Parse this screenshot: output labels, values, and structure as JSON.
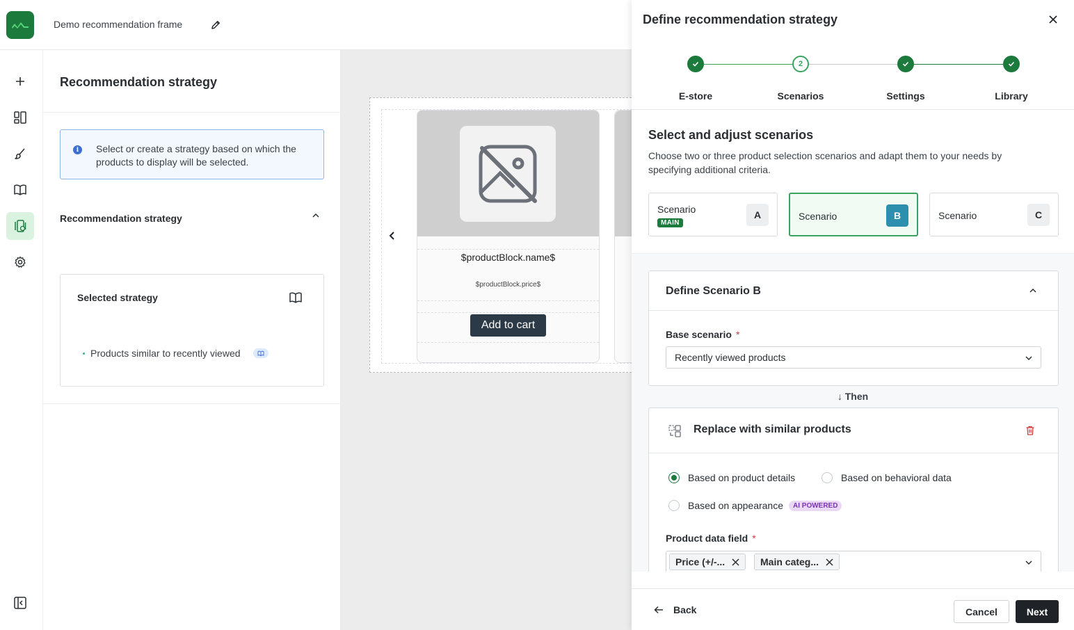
{
  "header": {
    "frame_title": "Demo recommendation frame",
    "logo_icon": "brand-logo",
    "edit_icon": "pencil-icon"
  },
  "rail": {
    "items": [
      {
        "icon": "plus-icon"
      },
      {
        "icon": "layout-icon"
      },
      {
        "icon": "brush-icon"
      },
      {
        "icon": "book-icon"
      },
      {
        "icon": "recommendation-icon",
        "active": true
      },
      {
        "icon": "gear-icon"
      },
      {
        "icon": "collapse-panel-icon"
      }
    ]
  },
  "panel": {
    "title": "Recommendation strategy",
    "info_text": "Select or create a strategy based on which the products to display will be selected.",
    "section_title": "Recommendation strategy",
    "selected": {
      "title": "Selected strategy",
      "item": "Products similar to recently viewed"
    }
  },
  "preview": {
    "product_name": "$productBlock.name$",
    "product_price": "$productBlock.price$",
    "cart_label": "Add to cart"
  },
  "drawer": {
    "title": "Define recommendation strategy",
    "steps": [
      {
        "label": "E-store",
        "state": "done"
      },
      {
        "label": "Scenarios",
        "state": "current",
        "number": "2"
      },
      {
        "label": "Settings",
        "state": "done"
      },
      {
        "label": "Library",
        "state": "done"
      }
    ],
    "section_title": "Select and adjust scenarios",
    "section_desc": "Choose two or three product selection scenarios and adapt them to your needs by specifying additional criteria.",
    "scenarios": [
      {
        "label": "Scenario",
        "letter": "A",
        "badge": "MAIN"
      },
      {
        "label": "Scenario",
        "letter": "B",
        "selected": true
      },
      {
        "label": "Scenario",
        "letter": "C"
      }
    ],
    "define": {
      "title": "Define Scenario B",
      "base_label": "Base scenario",
      "required_mark": "*",
      "base_value": "Recently viewed products"
    },
    "then_label": "Then",
    "replace": {
      "title": "Replace with similar products",
      "options": [
        {
          "label": "Based on product details",
          "checked": true
        },
        {
          "label": "Based on behavioral data",
          "checked": false
        },
        {
          "label": "Based on appearance",
          "checked": false,
          "badge": "AI POWERED"
        }
      ],
      "field_label": "Product data field",
      "tags": [
        "Price (+/-...",
        "Main categ..."
      ]
    },
    "footer": {
      "back": "Back",
      "cancel": "Cancel",
      "next": "Next"
    }
  },
  "colors": {
    "brand_green": "#1c7a3d",
    "accent_teal": "#2b8fad",
    "ai_purple": "#7a35b2",
    "danger": "#d13c3c"
  }
}
